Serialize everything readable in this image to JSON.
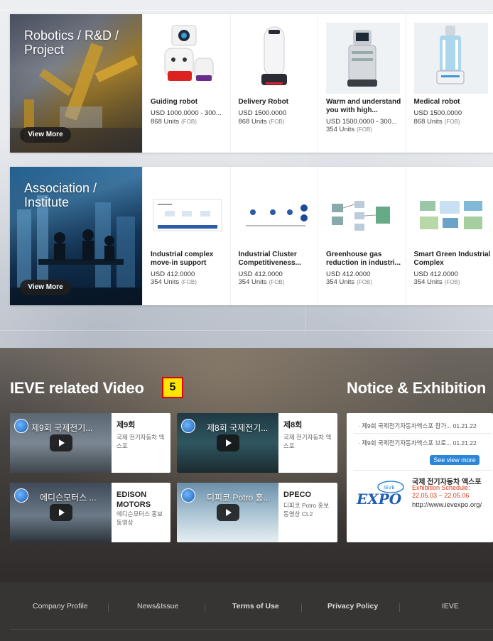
{
  "robotics": {
    "title": "Robotics / R&D / Project",
    "title_line1": "Robotics / R&D /",
    "title_line2": "Project",
    "view_more": "View More",
    "products": [
      {
        "name": "Guiding robot",
        "price": "USD 1000.0000 - 300...",
        "units": "868 Units",
        "fob": "(FOB)"
      },
      {
        "name": "Delivery Robot",
        "price": "USD 1500.0000",
        "units": "868 Units",
        "fob": "(FOB)"
      },
      {
        "name": "Warm and understand you with high...",
        "price": "USD 1500.0000 - 300...",
        "units": "354 Units",
        "fob": "(FOB)"
      },
      {
        "name": "Medical robot",
        "price": "USD 1500.0000",
        "units": "868 Units",
        "fob": "(FOB)"
      }
    ]
  },
  "association": {
    "title_line1": "Association /",
    "title_line2": "Institute",
    "view_more": "View More",
    "products": [
      {
        "name": "Industrial complex move-in support",
        "price": "USD 412.0000",
        "units": "354 Units",
        "fob": "(FOB)"
      },
      {
        "name": "Industrial Cluster Competitiveness...",
        "price": "USD 412.0000",
        "units": "354 Units",
        "fob": "(FOB)"
      },
      {
        "name": "Greenhouse gas reduction in industri...",
        "price": "USD 412.0000",
        "units": "354 Units",
        "fob": "(FOB)"
      },
      {
        "name": "Smart Green Industrial Complex",
        "price": "USD 412.0000",
        "units": "354 Units",
        "fob": "(FOB)"
      }
    ]
  },
  "videos": {
    "section_title": "IEVE related Video",
    "badge": "5",
    "items": [
      {
        "overlay": "제9회 국제전기...",
        "title": "제9회",
        "sub": "국제 전기자동차 엑스포"
      },
      {
        "overlay": "제8회 국제전기...",
        "title": "제8회",
        "sub": "국제 전기자동차 엑스포"
      },
      {
        "overlay": "에디슨모터스 ...",
        "title": "EDISON MOTORS",
        "sub": "에디슨모터스 홍보동영상"
      },
      {
        "overlay": "디피코 Potro 홍...",
        "title": "DPECO",
        "sub": "디피코 Potro 홍보 동영상 Ct.2"
      }
    ]
  },
  "notice": {
    "section_title": "Notice & Exhibition",
    "items": [
      {
        "text": "제9회 국제전기자동차엑스포 참가...",
        "date": "01.21.22"
      },
      {
        "text": "제9회 국제전기자동차엑스포 브로...",
        "date": "01.21.22"
      }
    ],
    "see_more": "See view more",
    "expo": {
      "title": "국제 전기자동차 엑스포",
      "schedule_label": "Exhibition Schedule:",
      "schedule_dates": "22.05.03 ~ 22.05.06",
      "url": "http://www.ievexpo.org/",
      "logo_text": "EXPO",
      "logo_badge": "IEVE"
    }
  },
  "footer": {
    "links": [
      "Company Profile",
      "News&Issue",
      "Terms of Use",
      "Privacy Policy",
      "IEVE"
    ]
  }
}
